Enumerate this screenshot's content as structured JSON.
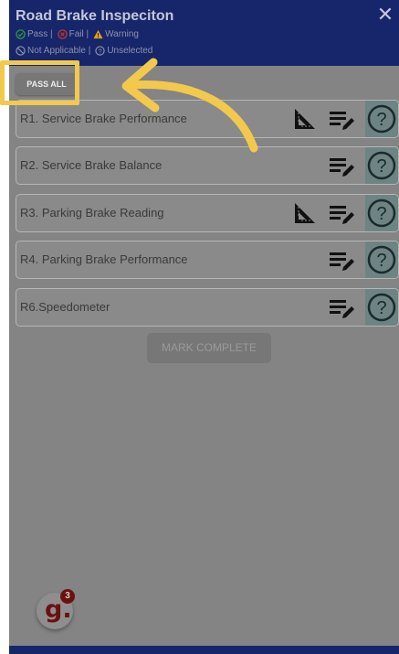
{
  "header": {
    "title": "Road Brake Inspeciton",
    "close_icon": "close-icon",
    "legend": {
      "pass": "Pass |",
      "fail": "Fail |",
      "warning": "Warning",
      "not_applicable": "Not Applicable |",
      "unselected": "Unselected"
    }
  },
  "toolbar": {
    "pass_all_label": "PASS ALL"
  },
  "items": [
    {
      "label": "R1. Service Brake Performance",
      "icons": [
        "ruler-icon",
        "notes-edit-icon",
        "help-icon"
      ]
    },
    {
      "label": "R2. Service Brake Balance",
      "icons": [
        "notes-edit-icon",
        "help-icon"
      ]
    },
    {
      "label": "R3. Parking Brake Reading",
      "icons": [
        "ruler-icon",
        "notes-edit-icon",
        "help-icon"
      ]
    },
    {
      "label": "R4. Parking Brake Performance",
      "icons": [
        "notes-edit-icon",
        "help-icon"
      ]
    },
    {
      "label": "R6.Speedometer",
      "icons": [
        "notes-edit-icon",
        "help-icon"
      ]
    }
  ],
  "footer": {
    "mark_complete_label": "MARK COMPLETE"
  },
  "logo": {
    "letter": "g.",
    "badge": "3"
  },
  "colors": {
    "header": "#17256b",
    "overlay": "#848484",
    "highlight": "#f2c94c",
    "pass": "#2e9b3f",
    "fail": "#c0392b",
    "warning": "#e6a010",
    "logo": "#6b1010"
  }
}
